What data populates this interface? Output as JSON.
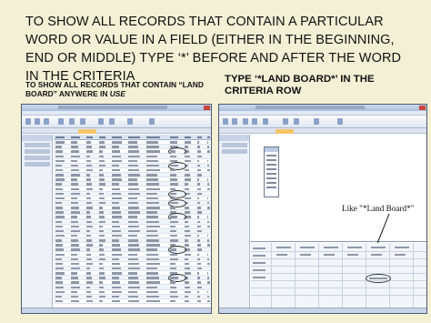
{
  "slide": {
    "title": "TO SHOW ALL RECORDS THAT CONTAIN A PARTICULAR WORD OR VALUE IN A FIELD (EITHER IN THE BEGINNING, END OR MIDDLE) TYPE ‘*’ BEFORE AND AFTER THE WORD IN THE CRITERIA",
    "left_heading_main": "TO SHOW ALL RECORDS THAT CONTAIN “LAND BOARD” ANYWERE IN ",
    "left_heading_em": "USE",
    "right_heading": "TYPE ‘*LAND BOARD*’ IN THE CRITERIA ROW",
    "criteria_example": "Like \"*Land Board*\""
  },
  "colors": {
    "background": "#f4f0d6",
    "window_title_bar": "#b9c9e3",
    "active_tab": "#f5c56a",
    "close_button": "#c9463d"
  },
  "icons": [
    "window-close-icon",
    "ribbon-tool-icon",
    "field-list-icon",
    "arrow-icon"
  ]
}
